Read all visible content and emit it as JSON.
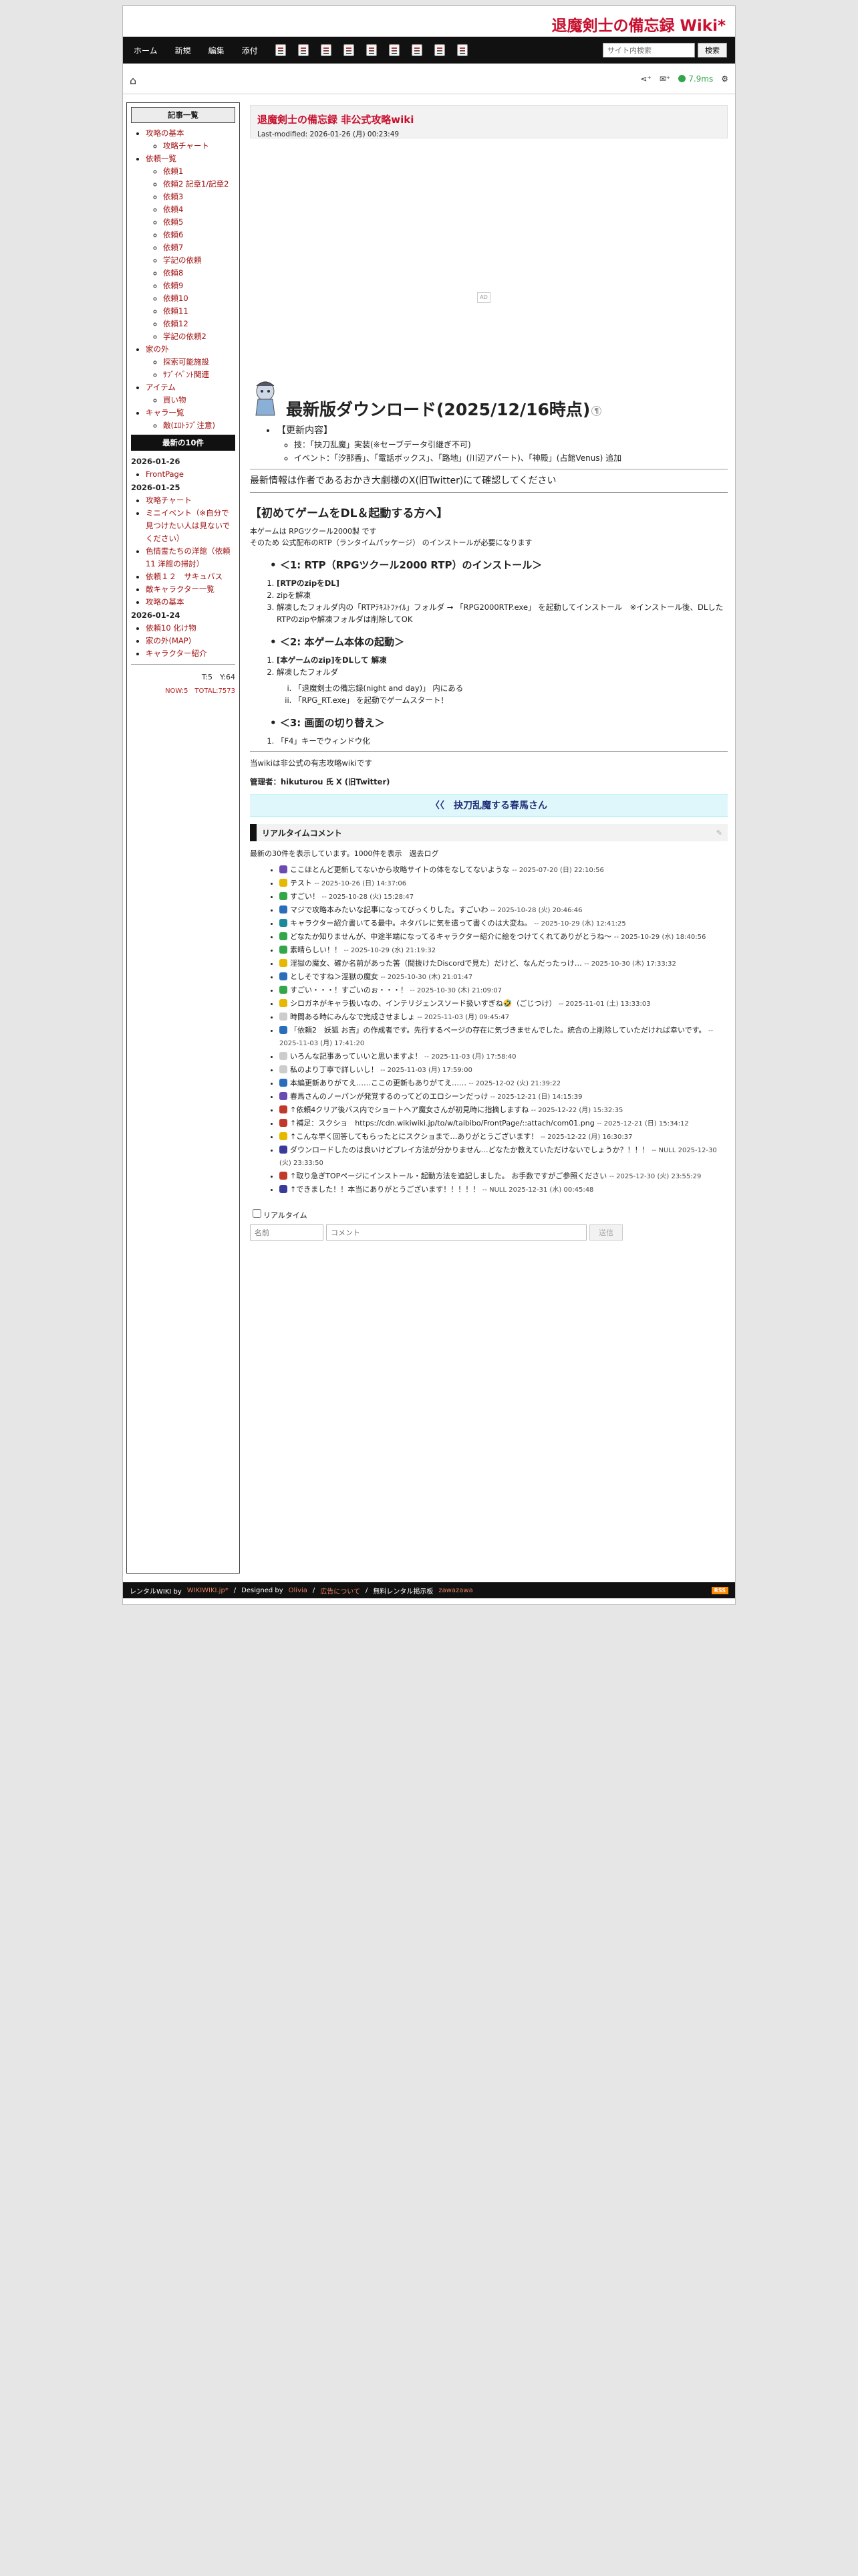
{
  "site": {
    "title": "退魔剣士の備忘録 Wiki*"
  },
  "nav": {
    "items": [
      "ホーム",
      "新規",
      "編集",
      "添付"
    ],
    "search_placeholder": "サイト内検索",
    "search_button": "検索"
  },
  "toolbar": {
    "time": "7.9ms"
  },
  "menubar": {
    "header": "記事一覧",
    "tree": [
      {
        "label": "攻略の基本",
        "children": [
          "攻略チャート"
        ]
      },
      {
        "label": "依頼一覧",
        "children": [
          "依頼1",
          "依頼2 記章1/記章2",
          "依頼3",
          "依頼4",
          "依頼5",
          "依頼6",
          "依頼7",
          "学記の依頼",
          "依頼8",
          "依頼9",
          "依頼10",
          "依頼11",
          "依頼12",
          "学記の依頼2"
        ]
      },
      {
        "label": "家の外",
        "children": [
          "探索可能施設",
          "ｻﾌﾞｲﾍﾞﾝﾄ関連"
        ]
      },
      {
        "label": "アイテム",
        "children": [
          "買い物"
        ]
      },
      {
        "label": "キャラ一覧",
        "children": [
          "敵(ｴﾛﾄﾗﾌﾞ注意)"
        ]
      }
    ],
    "recent_header": "最新の10件",
    "recent": [
      {
        "date": "2026-01-26",
        "items": [
          "FrontPage"
        ]
      },
      {
        "date": "2026-01-25",
        "items": [
          "攻略チャート",
          "ミニイベント（※自分で見つけたい人は見ないでください）",
          "色情霊たちの洋館（依頼11 洋館の掃討）",
          "依頼１２　サキュバス",
          "敵キャラクター一覧",
          "攻略の基本"
        ]
      },
      {
        "date": "2026-01-24",
        "items": [
          "依頼10 化け物",
          "家の外(MAP)",
          "キャラクター紹介"
        ]
      }
    ],
    "counter_top": "T:5　Y:64",
    "counter_bottom": "NOW:5　TOTAL:7573"
  },
  "main": {
    "title": "退魔剣士の備忘録 非公式攻略wiki",
    "last_modified": "Last-modified: 2026-01-26 (月) 00:23:49",
    "download_heading": "最新版ダウンロード(2025/12/16時点)",
    "update_label": "【更新内容】",
    "update_items": [
      "技：「抉刀乱魔」実装(※セーブデータ引継ぎ不可)",
      "イベント：「汐那香」、「電話ボックス」、「路地」(川辺アパート)、「神殿」(占館Venus) 追加"
    ],
    "notice_prefix": "最新情報は作者であるおかき大劇様のX(旧Twitter)",
    "notice_suffix": "にて確認してください",
    "howto_heading": "【初めてゲームをDL＆起動する方へ】",
    "howto_line1": "本ゲームは RPGツクール2000製 です",
    "howto_line2": "そのため 公式配布のRTP（ランタイムパッケージ） のインストールが必要になります",
    "sec1": "＜1: RTP（RPGツクール2000 RTP）のインストール＞",
    "sec1_items": [
      "[RTPのzipをDL]",
      "zipを解凍",
      "解凍したフォルダ内の「RTPﾃｷｽﾄﾌｧｲﾙ」フォルダ → 「RPG2000RTP.exe」 を起動してインストール　※インストール後、DLしたRTPのzipや解凍フォルダは削除してOK"
    ],
    "sec2": "＜2: 本ゲーム本体の起動＞",
    "sec2_items": [
      "[本ゲームのzip]をDLして 解凍",
      "解凍したフォルダ"
    ],
    "sec2_sub": [
      "「退魔剣士の備忘録(night and day)」 内にある",
      "「RPG_RT.exe」 を起動でゲームスタート！"
    ],
    "sec3": "＜3: 画面の切り替え＞",
    "sec3_items": [
      "「F4」キーでウィンドウ化"
    ],
    "footer_line1": "当wikiは非公式の有志攻略wikiです",
    "footer_line2": "管理者：hikuturou 氏 X (旧Twitter)",
    "banner": "〈〈　抉刀乱魔する春馬さん"
  },
  "realtime": {
    "heading": "リアルタイムコメント",
    "info": "最新の30件を表示しています。1000件を表示　過去ログ",
    "comments": [
      {
        "text": "ここほとんど更新してないから攻略サイトの体をなしてないような",
        "date": "-- 2025-07-20 (日) 22:10:56",
        "color": "#6a4bb3"
      },
      {
        "text": "テスト",
        "date": "-- 2025-10-26 (日) 14:37:06",
        "color": "#e6b800"
      },
      {
        "text": "すごい！",
        "date": "-- 2025-10-28 (火) 15:28:47",
        "color": "#33a64a"
      },
      {
        "text": "マジで攻略本みたいな記事になってびっくりした。すごいわ",
        "date": "-- 2025-10-28 (火) 20:46:46",
        "color": "#2a6ebb"
      },
      {
        "text": "キャラクター紹介書いてる最中。ネタバレに気を遣って書くのは大変ね。",
        "date": "-- 2025-10-29 (水) 12:41:25",
        "color": "#1b8a9a"
      },
      {
        "text": "どなたか知りませんが、中途半端になってるキャラクター紹介に絵をつけてくれてありがとうね～",
        "date": "-- 2025-10-29 (水) 18:40:56",
        "color": "#33a64a"
      },
      {
        "text": "素晴らしい！！",
        "date": "-- 2025-10-29 (水) 21:19:32",
        "color": "#33a64a"
      },
      {
        "text": "淫獄の魔女、確か名前があった筈（間抜けたDiscordで見た）だけど、なんだったっけ…",
        "date": "-- 2025-10-30 (木) 17:33:32",
        "color": "#e6b800"
      },
      {
        "text": "としそですね＞淫獄の魔女",
        "date": "-- 2025-10-30 (木) 21:01:47",
        "color": "#2a6ebb"
      },
      {
        "text": "すごい・・・！すごいのぉ・・・！",
        "date": "-- 2025-10-30 (木) 21:09:07",
        "color": "#33a64a"
      },
      {
        "text": "シロガネがキャラ扱いなの、インテリジェンスソード扱いすぎね🤣（ごじつけ）",
        "date": "-- 2025-11-01 (土) 13:33:03",
        "color": "#e6b800"
      },
      {
        "text": "時間ある時にみんなで完成させましょ",
        "date": "-- 2025-11-03 (月) 09:45:47",
        "color": "#cccccc"
      },
      {
        "text": "「依頼2　妖狐 お吉」の作成者です。先行するページの存在に気づきませんでした。統合の上削除していただければ幸いです。",
        "date": "-- 2025-11-03 (月) 17:41:20",
        "color": "#2a6ebb"
      },
      {
        "text": "いろんな記事あっていいと思いますよ！",
        "date": "-- 2025-11-03 (月) 17:58:40",
        "color": "#cccccc"
      },
      {
        "text": "私のより丁寧で詳しいし！",
        "date": "-- 2025-11-03 (月) 17:59:00",
        "color": "#cccccc"
      },
      {
        "text": "本編更新ありがてえ……ここの更新もありがてえ……",
        "date": "-- 2025-12-02 (火) 21:39:22",
        "color": "#2a6ebb"
      },
      {
        "text": "春馬さんのノーパンが発覚するのってどのエロシーンだっけ",
        "date": "-- 2025-12-21 (日) 14:15:39",
        "color": "#6a4bb3"
      },
      {
        "text": "↑依頼4クリア後バス内でショートヘア魔女さんが初見時に指摘しますね",
        "date": "-- 2025-12-22 (月) 15:32:35",
        "color": "#c0392b"
      },
      {
        "text": "↑補足：スクショ　https://cdn.wikiwiki.jp/to/w/taibibo/FrontPage/::attach/com01.png",
        "date": "-- 2025-12-21 (日) 15:34:12",
        "color": "#c0392b"
      },
      {
        "text": "↑こんな早く回答してもらったとにスクショまで…ありがとうございます！",
        "date": "-- 2025-12-22 (月) 16:30:37",
        "color": "#e6b800"
      },
      {
        "text": "ダウンロードしたのは良いけどプレイ方法が分かりません…どなたか教えていただけないでしょうか？！！！",
        "date": "-- NULL 2025-12-30 (火) 23:33:50",
        "color": "#3a3a9a"
      },
      {
        "text": "↑取り急ぎTOPページにインストール・起動方法を追記しました。 お手数ですがご参照ください",
        "date": "-- 2025-12-30 (火) 23:55:29",
        "color": "#c0392b"
      },
      {
        "text": "↑できました！！本当にありがとうございます！！！！！",
        "date": "-- NULL 2025-12-31 (水) 00:45:48",
        "color": "#3a3a9a"
      }
    ],
    "checkbox_label": "リアルタイム",
    "name_placeholder": "名前",
    "comment_placeholder": "コメント",
    "submit": "送信"
  },
  "footer": {
    "rental": "レンタルWIKI by",
    "rental_link": "WIKIWIKI.jp*",
    "designed": "Designed by",
    "designer": "Olivia",
    "ad_link": "広告について",
    "free_rental": "無料レンタル掲示板",
    "free_link": "zawazawa",
    "rss": "RSS"
  }
}
